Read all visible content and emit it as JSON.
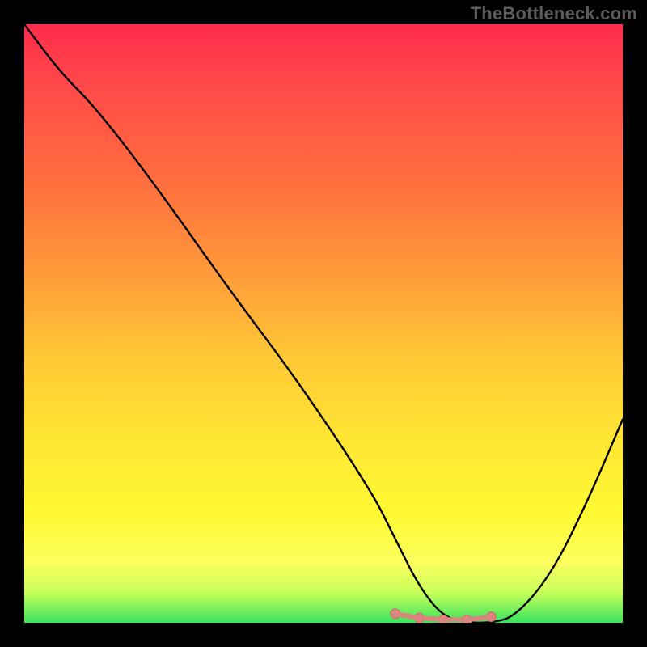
{
  "watermark": "TheBottleneck.com",
  "colors": {
    "background": "#000000",
    "gradient_top": "#ff2b4c",
    "gradient_bottom": "#38e35e",
    "curve": "#000000",
    "marker_fill": "#d9867e",
    "marker_stroke": "#c76d63"
  },
  "chart_data": {
    "type": "line",
    "title": "",
    "xlabel": "",
    "ylabel": "",
    "xlim": [
      0,
      100
    ],
    "ylim": [
      0,
      100
    ],
    "grid": false,
    "legend": false,
    "series": [
      {
        "name": "bottleneck-curve",
        "x": [
          0,
          6,
          12,
          22,
          34,
          46,
          58,
          62,
          66,
          70,
          74,
          78,
          82,
          88,
          94,
          100
        ],
        "values": [
          100,
          92,
          86,
          73,
          56,
          40,
          22,
          14,
          6,
          1,
          0,
          0,
          1,
          8,
          20,
          34
        ]
      }
    ],
    "markers": {
      "name": "valley-highlight",
      "x": [
        62,
        66,
        70,
        74,
        78
      ],
      "values": [
        1.5,
        0.8,
        0.5,
        0.5,
        1.0
      ]
    }
  }
}
